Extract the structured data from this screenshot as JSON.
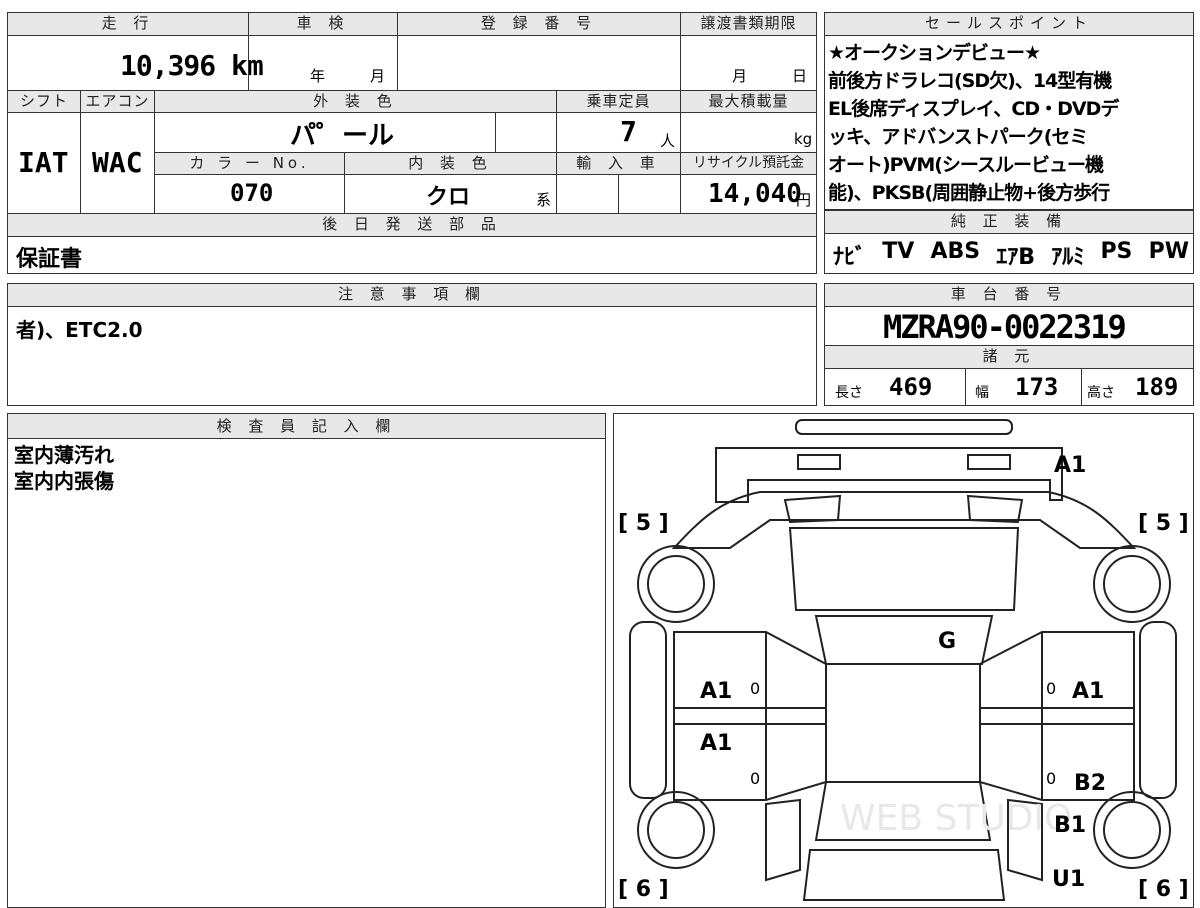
{
  "vehicle": {
    "mileage_header": "走 行",
    "mileage": "10,396 km",
    "inspection_header": "車 検",
    "inspection_year_unit": "年",
    "inspection_month_unit": "月",
    "registration_header": "登 録 番 号",
    "registration_value": "",
    "transfer_header": "譲渡書類期限",
    "transfer_month_unit": "月",
    "transfer_day_unit": "日",
    "shift_header": "シフト",
    "shift": "IAT",
    "ac_header": "エアコン",
    "ac": "WAC",
    "exterior_header": "外 装 色",
    "exterior_color": "パ゜ール",
    "capacity_header": "乗車定員",
    "capacity": "7",
    "capacity_unit": "人",
    "max_load_header": "最大積載量",
    "max_load_unit": "kg",
    "color_no_header": "カ ラ ー No.",
    "color_no": "070",
    "interior_header": "内 装 色",
    "interior_color": "クロ",
    "interior_suffix": "系",
    "import_header": "輸 入 車",
    "recycle_header": "リサイクル預託金",
    "recycle_fee": "14,040",
    "recycle_unit": "円",
    "later_parts_header": "後 日 発 送 部 品",
    "later_parts": "保証書"
  },
  "sales_points": {
    "header": "セールスポイント",
    "lines": [
      "★オークションデビュー★",
      "前後方ドラレコ(SD欠)、14型有機",
      "EL後席ディスプレイ、CD・DVDデ",
      "ッキ、アドバンストパーク(セミ",
      "オート)PVM(シースルービュー機",
      "能)、PKSB(周囲静止物+後方歩行"
    ]
  },
  "equipment": {
    "header": "純 正 装 備",
    "items": [
      "ﾅﾋﾞ",
      "TV",
      "ABS",
      "ｴｱB",
      "ｱﾙﾐ",
      "PS",
      "PW"
    ]
  },
  "notes": {
    "header": "注 意 事 項 欄",
    "text": "者)、ETC2.0"
  },
  "chassis": {
    "header": "車 台 番 号",
    "number": "MZRA90-0022319",
    "spec_header": "諸 元",
    "length_label": "長さ",
    "length": "469",
    "width_label": "幅",
    "width": "173",
    "height_label": "高さ",
    "height": "189"
  },
  "inspector": {
    "header": "検 査 員 記 入 欄",
    "lines": [
      "室内薄汚れ",
      "室内内張傷"
    ]
  },
  "diagram": {
    "tire_labels": [
      "[ 5 ]",
      "[ 5 ]",
      "[ 6 ]",
      "[ 6 ]"
    ],
    "damage_codes": {
      "front_bumper": "A1",
      "windshield": "G",
      "left_front_door": "A1",
      "left_rear_door": "A1",
      "right_front_door": "A1",
      "right_rear_door": "B2",
      "right_rear_quarter": "B1",
      "right_rear": "U1"
    },
    "door_marks": [
      "0",
      "0",
      "0",
      "0"
    ],
    "watermark": "WEB STUDIO"
  }
}
